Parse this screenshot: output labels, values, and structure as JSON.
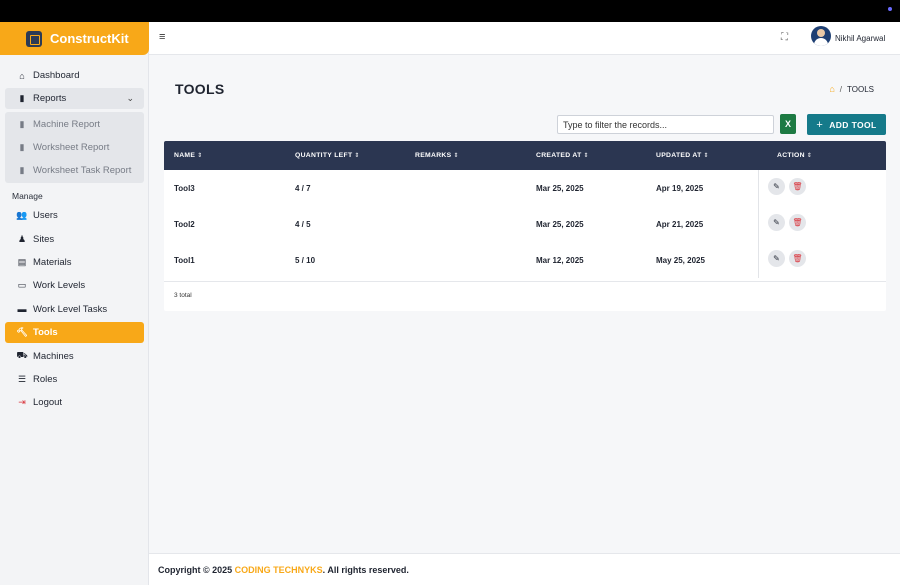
{
  "app": {
    "name": "ConstructKit"
  },
  "sidebar": {
    "dashboard": "Dashboard",
    "reports": {
      "label": "Reports",
      "items": [
        "Machine Report",
        "Worksheet Report",
        "Worksheet Task Report"
      ]
    },
    "section_label": "Manage",
    "items": [
      "Users",
      "Sites",
      "Materials",
      "Work Levels",
      "Work Level Tasks",
      "Tools",
      "Machines",
      "Roles"
    ],
    "logout": "Logout"
  },
  "header": {
    "user_name": "Nikhil Agarwal"
  },
  "page": {
    "title": "TOOLS",
    "breadcrumb": "TOOLS",
    "filter_placeholder": "Type to filter the records...",
    "add_button": "ADD TOOL"
  },
  "table": {
    "columns": [
      "NAME",
      "QUANTITY LEFT",
      "REMARKS",
      "CREATED AT",
      "UPDATED AT",
      "ACTION"
    ],
    "rows": [
      {
        "name": "Tool3",
        "quantity": "4 / 7",
        "remarks": "",
        "created": "Mar 25, 2025",
        "updated": "Apr 19, 2025"
      },
      {
        "name": "Tool2",
        "quantity": "4 / 5",
        "remarks": "",
        "created": "Mar 25, 2025",
        "updated": "Apr 21, 2025"
      },
      {
        "name": "Tool1",
        "quantity": "5 / 10",
        "remarks": "",
        "created": "Mar 12, 2025",
        "updated": "May 25, 2025"
      }
    ],
    "total": "3 total"
  },
  "footer": {
    "prefix": "Copyright © 2025 ",
    "company": "CODING TECHNYKS",
    "suffix": ". All rights reserved."
  },
  "colors": {
    "accent": "#f8a818",
    "table_header": "#2b3651",
    "primary_button": "#157a8a",
    "danger": "#d9363e"
  }
}
